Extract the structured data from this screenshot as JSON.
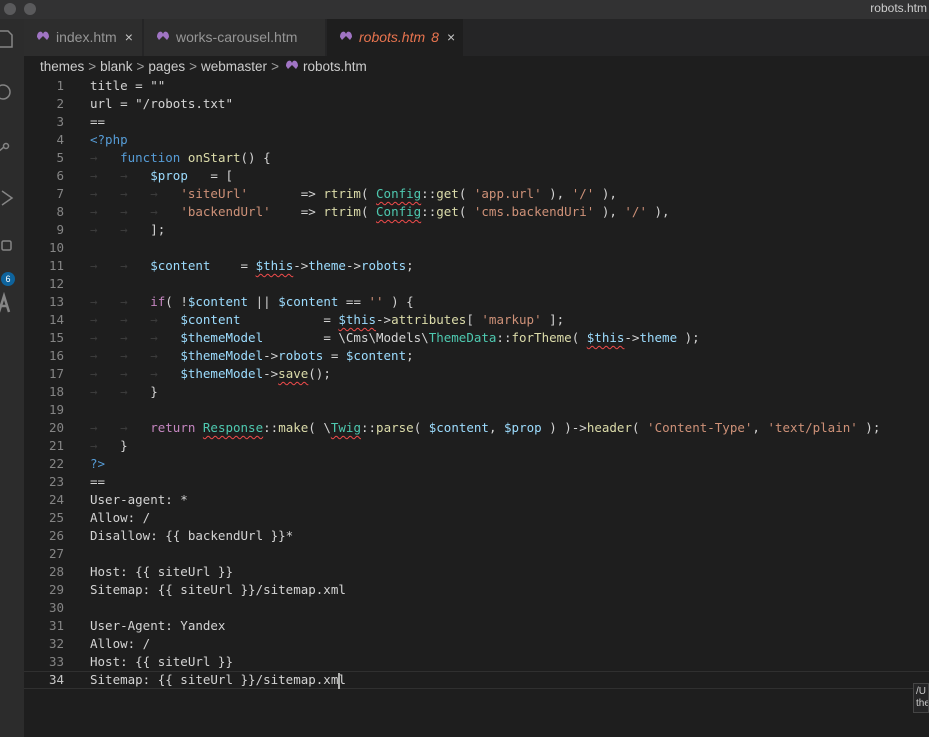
{
  "window": {
    "title": "robots.htm"
  },
  "activity_bar": {
    "icons": [
      "explorer-icon",
      "search-icon",
      "source-control-icon",
      "run-debug-icon",
      "extensions-icon",
      "text-icon"
    ],
    "extensions_badge": "6",
    "badge_color": "#0e639c"
  },
  "tabs": [
    {
      "label": "index.htm",
      "icon": "file-icon",
      "close": "×",
      "active": false
    },
    {
      "label": "works-carousel.htm",
      "icon": "file-icon",
      "active": false
    },
    {
      "label": "robots.htm",
      "icon": "file-icon",
      "modified_count": "8",
      "close": "×",
      "active": true
    }
  ],
  "breadcrumb": {
    "items": [
      "themes",
      "blank",
      "pages",
      "webmaster",
      "robots.htm"
    ],
    "separator": ">"
  },
  "editor": {
    "current_line": 34,
    "lines": [
      {
        "n": "1",
        "tokens": [
          [
            "t-plain",
            "title = \"\""
          ]
        ]
      },
      {
        "n": "2",
        "tokens": [
          [
            "t-plain",
            "url = \"/robots.txt\""
          ]
        ]
      },
      {
        "n": "3",
        "tokens": [
          [
            "t-plain",
            "=="
          ]
        ]
      },
      {
        "n": "4",
        "tokens": [
          [
            "t-php",
            "<?php"
          ]
        ]
      },
      {
        "n": "5",
        "tokens": [
          [
            "ws",
            "→   "
          ],
          [
            "t-kw",
            "function "
          ],
          [
            "t-fn",
            "onStart"
          ],
          [
            "t-plain",
            "() {"
          ]
        ]
      },
      {
        "n": "6",
        "tokens": [
          [
            "ws",
            "→   →   "
          ],
          [
            "t-var",
            "$prop"
          ],
          [
            "t-plain",
            "   = ["
          ]
        ]
      },
      {
        "n": "7",
        "tokens": [
          [
            "ws",
            "→   →   →   "
          ],
          [
            "t-str",
            "'siteUrl'"
          ],
          [
            "t-plain",
            "       => "
          ],
          [
            "t-fn",
            "rtrim"
          ],
          [
            "t-plain",
            "( "
          ],
          [
            "t-cls squig",
            "Config"
          ],
          [
            "t-plain",
            "::"
          ],
          [
            "t-fn",
            "get"
          ],
          [
            "t-plain",
            "( "
          ],
          [
            "t-str",
            "'app.url'"
          ],
          [
            "t-plain",
            " ), "
          ],
          [
            "t-str",
            "'/'"
          ],
          [
            "t-plain",
            " ),"
          ]
        ]
      },
      {
        "n": "8",
        "tokens": [
          [
            "ws",
            "→   →   →   "
          ],
          [
            "t-str",
            "'backendUrl'"
          ],
          [
            "t-plain",
            "    => "
          ],
          [
            "t-fn",
            "rtrim"
          ],
          [
            "t-plain",
            "( "
          ],
          [
            "t-cls squig",
            "Config"
          ],
          [
            "t-plain",
            "::"
          ],
          [
            "t-fn",
            "get"
          ],
          [
            "t-plain",
            "( "
          ],
          [
            "t-str",
            "'cms.backendUri'"
          ],
          [
            "t-plain",
            " ), "
          ],
          [
            "t-str",
            "'/'"
          ],
          [
            "t-plain",
            " ),"
          ]
        ]
      },
      {
        "n": "9",
        "tokens": [
          [
            "ws",
            "→   →   "
          ],
          [
            "t-plain",
            "];"
          ]
        ]
      },
      {
        "n": "10",
        "tokens": []
      },
      {
        "n": "11",
        "tokens": [
          [
            "ws",
            "→   →   "
          ],
          [
            "t-var",
            "$content"
          ],
          [
            "t-plain",
            "    = "
          ],
          [
            "t-var squig",
            "$this"
          ],
          [
            "t-plain",
            "->"
          ],
          [
            "t-var",
            "theme"
          ],
          [
            "t-plain",
            "->"
          ],
          [
            "t-var",
            "robots"
          ],
          [
            "t-plain",
            ";"
          ]
        ]
      },
      {
        "n": "12",
        "tokens": []
      },
      {
        "n": "13",
        "tokens": [
          [
            "ws",
            "→   →   "
          ],
          [
            "t-ctl",
            "if"
          ],
          [
            "t-plain",
            "( !"
          ],
          [
            "t-var",
            "$content"
          ],
          [
            "t-plain",
            " || "
          ],
          [
            "t-var",
            "$content"
          ],
          [
            "t-plain",
            " == "
          ],
          [
            "t-str",
            "''"
          ],
          [
            "t-plain",
            " ) {"
          ]
        ]
      },
      {
        "n": "14",
        "tokens": [
          [
            "ws",
            "→   →   →   "
          ],
          [
            "t-var",
            "$content"
          ],
          [
            "t-plain",
            "           = "
          ],
          [
            "t-var squig",
            "$this"
          ],
          [
            "t-plain",
            "->"
          ],
          [
            "t-fn",
            "attributes"
          ],
          [
            "t-plain",
            "[ "
          ],
          [
            "t-str",
            "'markup'"
          ],
          [
            "t-plain",
            " ];"
          ]
        ]
      },
      {
        "n": "15",
        "tokens": [
          [
            "ws",
            "→   →   →   "
          ],
          [
            "t-var",
            "$themeModel"
          ],
          [
            "t-plain",
            "        = \\Cms\\Models\\"
          ],
          [
            "t-cls",
            "ThemeData"
          ],
          [
            "t-plain",
            "::"
          ],
          [
            "t-fn",
            "forTheme"
          ],
          [
            "t-plain",
            "( "
          ],
          [
            "t-var squig",
            "$this"
          ],
          [
            "t-plain",
            "->"
          ],
          [
            "t-var",
            "theme"
          ],
          [
            "t-plain",
            " );"
          ]
        ]
      },
      {
        "n": "16",
        "tokens": [
          [
            "ws",
            "→   →   →   "
          ],
          [
            "t-var",
            "$themeModel"
          ],
          [
            "t-plain",
            "->"
          ],
          [
            "t-var",
            "robots"
          ],
          [
            "t-plain",
            " = "
          ],
          [
            "t-var",
            "$content"
          ],
          [
            "t-plain",
            ";"
          ]
        ]
      },
      {
        "n": "17",
        "tokens": [
          [
            "ws",
            "→   →   →   "
          ],
          [
            "t-var",
            "$themeModel"
          ],
          [
            "t-plain",
            "->"
          ],
          [
            "t-fn squig",
            "save"
          ],
          [
            "t-plain",
            "();"
          ]
        ]
      },
      {
        "n": "18",
        "tokens": [
          [
            "ws",
            "→   →   "
          ],
          [
            "t-plain",
            "}"
          ]
        ]
      },
      {
        "n": "19",
        "tokens": []
      },
      {
        "n": "20",
        "tokens": [
          [
            "ws",
            "→   →   "
          ],
          [
            "t-ctl",
            "return "
          ],
          [
            "t-cls squig",
            "Response"
          ],
          [
            "t-plain",
            "::"
          ],
          [
            "t-fn",
            "make"
          ],
          [
            "t-plain",
            "( \\"
          ],
          [
            "t-cls squig",
            "Twig"
          ],
          [
            "t-plain",
            "::"
          ],
          [
            "t-fn",
            "parse"
          ],
          [
            "t-plain",
            "( "
          ],
          [
            "t-var",
            "$content"
          ],
          [
            "t-plain",
            ", "
          ],
          [
            "t-var",
            "$prop"
          ],
          [
            "t-plain",
            " ) )->"
          ],
          [
            "t-fn",
            "header"
          ],
          [
            "t-plain",
            "( "
          ],
          [
            "t-str",
            "'Content-Type'"
          ],
          [
            "t-plain",
            ", "
          ],
          [
            "t-str",
            "'text/plain'"
          ],
          [
            "t-plain",
            " );"
          ]
        ]
      },
      {
        "n": "21",
        "tokens": [
          [
            "ws",
            "→   "
          ],
          [
            "t-plain",
            "}"
          ]
        ]
      },
      {
        "n": "22",
        "tokens": [
          [
            "t-php",
            "?>"
          ]
        ]
      },
      {
        "n": "23",
        "tokens": [
          [
            "t-plain",
            "=="
          ]
        ]
      },
      {
        "n": "24",
        "tokens": [
          [
            "t-plain",
            "User-agent: *"
          ]
        ]
      },
      {
        "n": "25",
        "tokens": [
          [
            "t-plain",
            "Allow: /"
          ]
        ]
      },
      {
        "n": "26",
        "tokens": [
          [
            "t-plain",
            "Disallow: {{ backendUrl }}*"
          ]
        ]
      },
      {
        "n": "27",
        "tokens": []
      },
      {
        "n": "28",
        "tokens": [
          [
            "t-plain",
            "Host: {{ siteUrl }}"
          ]
        ]
      },
      {
        "n": "29",
        "tokens": [
          [
            "t-plain",
            "Sitemap: {{ siteUrl }}/sitemap.xml"
          ]
        ]
      },
      {
        "n": "30",
        "tokens": []
      },
      {
        "n": "31",
        "tokens": [
          [
            "t-plain",
            "User-Agent: Yandex"
          ]
        ]
      },
      {
        "n": "32",
        "tokens": [
          [
            "t-plain",
            "Allow: /"
          ]
        ]
      },
      {
        "n": "33",
        "tokens": [
          [
            "t-plain",
            "Host: {{ siteUrl }}"
          ]
        ]
      },
      {
        "n": "34",
        "tokens": [
          [
            "t-plain",
            "Sitemap: {{ siteUrl }}/sitemap.xml"
          ]
        ]
      }
    ]
  },
  "hover_tooltip": {
    "text": "/U\nthe"
  }
}
